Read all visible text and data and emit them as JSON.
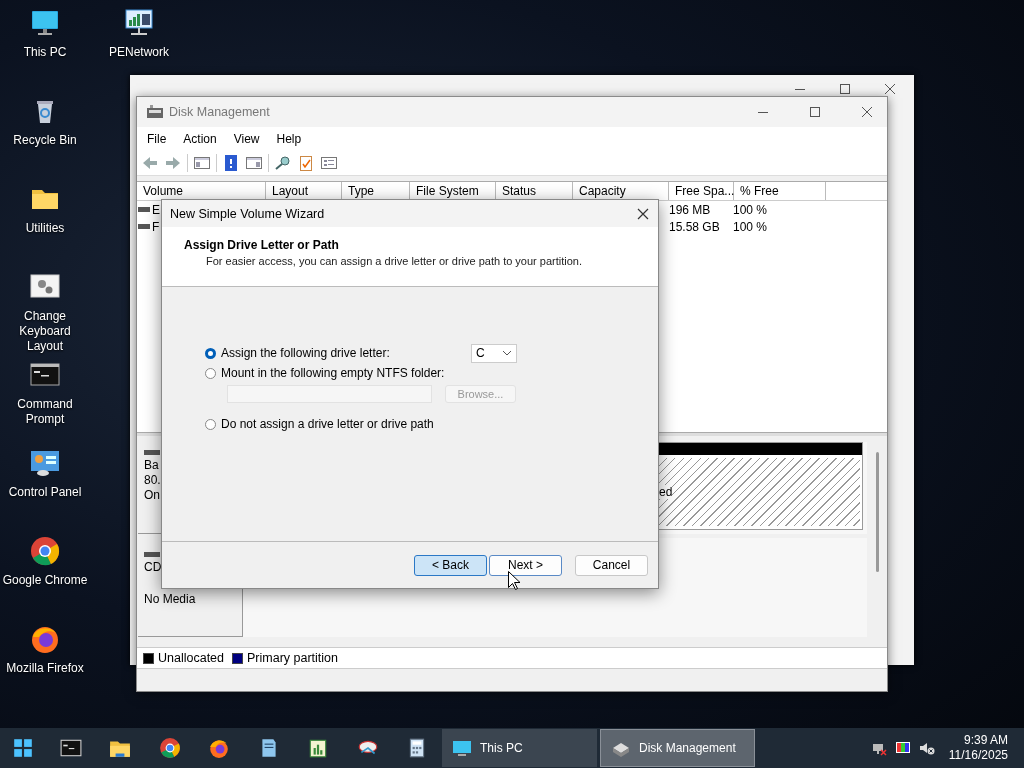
{
  "desktop_icons": [
    {
      "label": "This PC"
    },
    {
      "label": "PENetwork"
    },
    {
      "label": "Recycle Bin"
    },
    {
      "label": "Utilities"
    },
    {
      "label": "Change Keyboard Layout"
    },
    {
      "label": "Command Prompt"
    },
    {
      "label": "Control Panel"
    },
    {
      "label": "Google Chrome"
    },
    {
      "label": "Mozilla Firefox"
    }
  ],
  "disk_management": {
    "title": "Disk Management",
    "menu": [
      "File",
      "Action",
      "View",
      "Help"
    ],
    "columns": [
      "Volume",
      "Layout",
      "Type",
      "File System",
      "Status",
      "Capacity",
      "Free Spa...",
      "% Free"
    ],
    "rows": [
      {
        "volume": "E",
        "free_space": "196 MB",
        "percent_free": "100 %"
      },
      {
        "volume": "F",
        "free_space": "15.58 GB",
        "percent_free": "100 %"
      }
    ],
    "disks": [
      {
        "label_lines": [
          "Ba",
          "80.",
          "On"
        ],
        "partition_text": "ed"
      },
      {
        "label_lines": [
          "CD",
          "No Media"
        ]
      }
    ],
    "legend": [
      {
        "label": "Unallocated",
        "color": "#000000"
      },
      {
        "label": "Primary partition",
        "color": "#00007f"
      }
    ]
  },
  "wizard": {
    "title": "New Simple Volume Wizard",
    "heading": "Assign Drive Letter or Path",
    "description": "For easier access, you can assign a drive letter or drive path to your partition.",
    "options": [
      {
        "label": "Assign the following drive letter:",
        "selected": true
      },
      {
        "label": "Mount in the following empty NTFS folder:",
        "selected": false
      },
      {
        "label": "Do not assign a drive letter or drive path",
        "selected": false
      }
    ],
    "drive_letter": "C",
    "browse_button": {
      "label": "Browse...",
      "disabled": true
    },
    "buttons": [
      {
        "label": "< Back",
        "highlighted": true
      },
      {
        "label": "Next >",
        "highlighted": false
      },
      {
        "label": "Cancel",
        "highlighted": false
      }
    ]
  },
  "taskbar": {
    "apps": [
      {
        "label": "This PC",
        "active": false
      },
      {
        "label": "Disk Management",
        "active": true
      }
    ],
    "time": "9:39 AM",
    "date": "11/16/2025"
  }
}
